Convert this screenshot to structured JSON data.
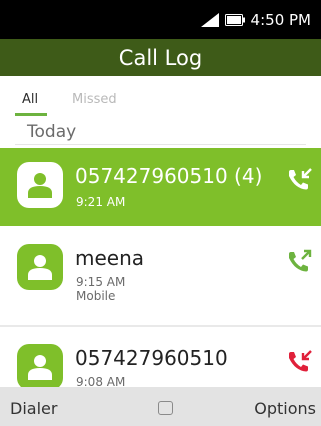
{
  "status": {
    "time": "4:50 PM",
    "signal_icon": "signal-icon",
    "battery_icon": "battery-icon"
  },
  "app": {
    "title": "Call Log"
  },
  "tabs": [
    {
      "label": "All",
      "active": true
    },
    {
      "label": "Missed",
      "active": false
    }
  ],
  "section": {
    "label": "Today"
  },
  "calls": [
    {
      "name": "057427960510 (4)",
      "time": "9:21 AM",
      "detail": "",
      "direction": "incoming",
      "selected": true,
      "icon_color": "#ffffff"
    },
    {
      "name": "meena",
      "time": "9:15 AM",
      "detail": "Mobile",
      "direction": "outgoing",
      "selected": false,
      "icon_color": "#6db33f"
    },
    {
      "name": "057427960510",
      "time": "9:08 AM",
      "detail": "",
      "direction": "missed",
      "selected": false,
      "icon_color": "#e0203a"
    }
  ],
  "softkeys": {
    "left": "Dialer",
    "center_icon": "select-icon",
    "right": "Options"
  },
  "colors": {
    "accent": "#7fbf2a",
    "header": "#3e5b18",
    "missed": "#e0203a"
  }
}
